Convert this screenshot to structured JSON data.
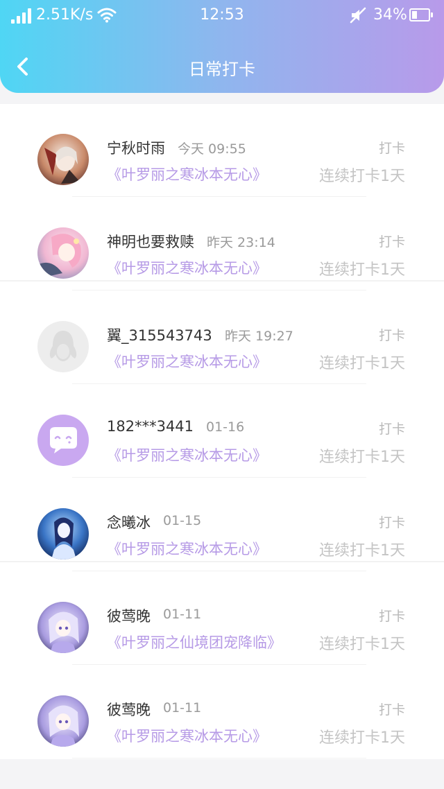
{
  "status_bar": {
    "network_speed": "2.51K/s",
    "time": "12:53",
    "battery_percent": "34%",
    "signal_icon": "signal-icon",
    "wifi_icon": "wifi-icon",
    "mute_icon": "mute-icon",
    "battery_icon": "battery-icon",
    "battery_level": 0.34
  },
  "header": {
    "title": "日常打卡",
    "back_icon": "chevron-left-icon",
    "gradient": [
      "#4fd6f4",
      "#b89aea"
    ]
  },
  "colors": {
    "book_title": "#b69ae6",
    "muted": "#b9b9b9"
  },
  "checkins": [
    {
      "name": "宁秋时雨",
      "time": "今天 09:55",
      "action": "打卡",
      "book": "《叶罗丽之寒冰本无心》",
      "streak": "连续打卡1天",
      "avatar": "anime-avatar-1"
    },
    {
      "name": "神明也要救赎",
      "time": "昨天 23:14",
      "action": "打卡",
      "book": "《叶罗丽之寒冰本无心》",
      "streak": "连续打卡1天",
      "avatar": "anime-avatar-2"
    },
    {
      "name": "翼_315543743",
      "time": "昨天 19:27",
      "action": "打卡",
      "book": "《叶罗丽之寒冰本无心》",
      "streak": "连续打卡1天",
      "avatar": "default-penguin-avatar"
    },
    {
      "name": "182***3441",
      "time": "01-16",
      "action": "打卡",
      "book": "《叶罗丽之寒冰本无心》",
      "streak": "连续打卡1天",
      "avatar": "chat-bubble-avatar"
    },
    {
      "name": "念曦冰",
      "time": "01-15",
      "action": "打卡",
      "book": "《叶罗丽之寒冰本无心》",
      "streak": "连续打卡1天",
      "avatar": "anime-avatar-3"
    },
    {
      "name": "彼莺晚",
      "time": "01-11",
      "action": "打卡",
      "book": "《叶罗丽之仙境团宠降临》",
      "streak": "连续打卡1天",
      "avatar": "anime-avatar-4"
    },
    {
      "name": "彼莺晚",
      "time": "01-11",
      "action": "打卡",
      "book": "《叶罗丽之寒冰本无心》",
      "streak": "连续打卡1天",
      "avatar": "anime-avatar-4"
    }
  ]
}
